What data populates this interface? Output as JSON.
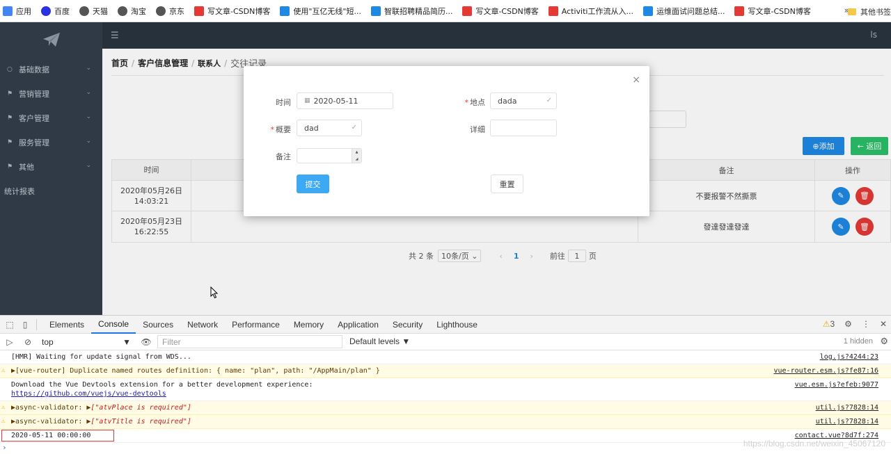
{
  "bookmarks": {
    "items": [
      {
        "label": "应用",
        "color": "#4285f4"
      },
      {
        "label": "百度",
        "color": "#2932e1"
      },
      {
        "label": "天猫",
        "color": "#555555"
      },
      {
        "label": "淘宝",
        "color": "#555555"
      },
      {
        "label": "京东",
        "color": "#555555"
      },
      {
        "label": "写文章-CSDN博客",
        "color": "#e53935"
      },
      {
        "label": "使用\"互亿无线\"短...",
        "color": "#1e88e5"
      },
      {
        "label": "智联招聘精品简历...",
        "color": "#1e88e5"
      },
      {
        "label": "写文章-CSDN博客",
        "color": "#e53935"
      },
      {
        "label": "Activiti工作流从入...",
        "color": "#e53935"
      },
      {
        "label": "运维面试问题总结...",
        "color": "#1e88e5"
      },
      {
        "label": "写文章-CSDN博客",
        "color": "#e53935"
      }
    ],
    "more": "»",
    "other": "其他书签"
  },
  "sidebar": {
    "items": [
      {
        "label": "基础数据",
        "icon": "○"
      },
      {
        "label": "营销管理",
        "icon": "⚑"
      },
      {
        "label": "客户管理",
        "icon": "⚑"
      },
      {
        "label": "服务管理",
        "icon": "⚑"
      },
      {
        "label": "其他",
        "icon": "⚑"
      },
      {
        "label": "统计报表",
        "icon": ""
      }
    ]
  },
  "topbar": {
    "toggle": "☰",
    "user": "ls"
  },
  "breadcrumb": {
    "home": "首页",
    "customer": "客户信息管理",
    "contact": "联系人",
    "current": "交往记录"
  },
  "buttons": {
    "add": "⊕添加",
    "back": "← 返回"
  },
  "table": {
    "headers": {
      "time": "时间",
      "note": "备注",
      "ops": "操作"
    },
    "rows": [
      {
        "time": "2020年05月26日 14:03:21",
        "note": "不要报警不然撕票"
      },
      {
        "time": "2020年05月23日 16:22:55",
        "note": "發達發達發達"
      }
    ]
  },
  "pagination": {
    "total": "共 2 条",
    "size": "10条/页 ⌄",
    "prev": "‹",
    "page": "1",
    "next": "›",
    "goto": "前往",
    "goto_value": "1",
    "unit": "页"
  },
  "dialog": {
    "close": "×",
    "time_label": "时间",
    "time_value": "2020-05-11",
    "place_label": "地点",
    "place_value": "dada",
    "title_label": "概要",
    "title_value": "dad",
    "detail_label": "详细",
    "detail_value": "",
    "remark_label": "备注",
    "submit": "提交",
    "reset": "重置"
  },
  "devtools": {
    "tabs": [
      "Elements",
      "Console",
      "Sources",
      "Network",
      "Performance",
      "Memory",
      "Application",
      "Security",
      "Lighthouse"
    ],
    "active_tab": "Console",
    "warn_count": "3",
    "context": "top",
    "filter_placeholder": "Filter",
    "levels": "Default levels ▼",
    "hidden": "1 hidden",
    "logs": [
      {
        "text": "[HMR] Waiting for update signal from WDS...",
        "src": "log.js?4244:23",
        "warn": false
      },
      {
        "text": "▶[vue-router] Duplicate named routes definition: { name: \"plan\", path: \"/AppMain/plan\" }",
        "src": "vue-router.esm.js?fe87:16",
        "warn": true
      },
      {
        "text": "Download the Vue Devtools extension for a better development experience:",
        "link": "https://github.com/vuejs/vue-devtools",
        "src": "vue.esm.js?efeb:9077",
        "warn": false
      },
      {
        "prefix": "▶async-validator: ▶",
        "red": "[\"atvPlace is required\"]",
        "src": "util.js?7828:14",
        "warn": true
      },
      {
        "prefix": "▶async-validator: ▶",
        "red": "[\"atvTitle is required\"]",
        "src": "util.js?7828:14",
        "warn": true
      },
      {
        "text": "2020-05-11 00:00:00",
        "src": "contact.vue?8d7f:274",
        "warn": false
      }
    ],
    "prompt": "›"
  },
  "watermark": "https://blog.csdn.net/weixin_45067120"
}
